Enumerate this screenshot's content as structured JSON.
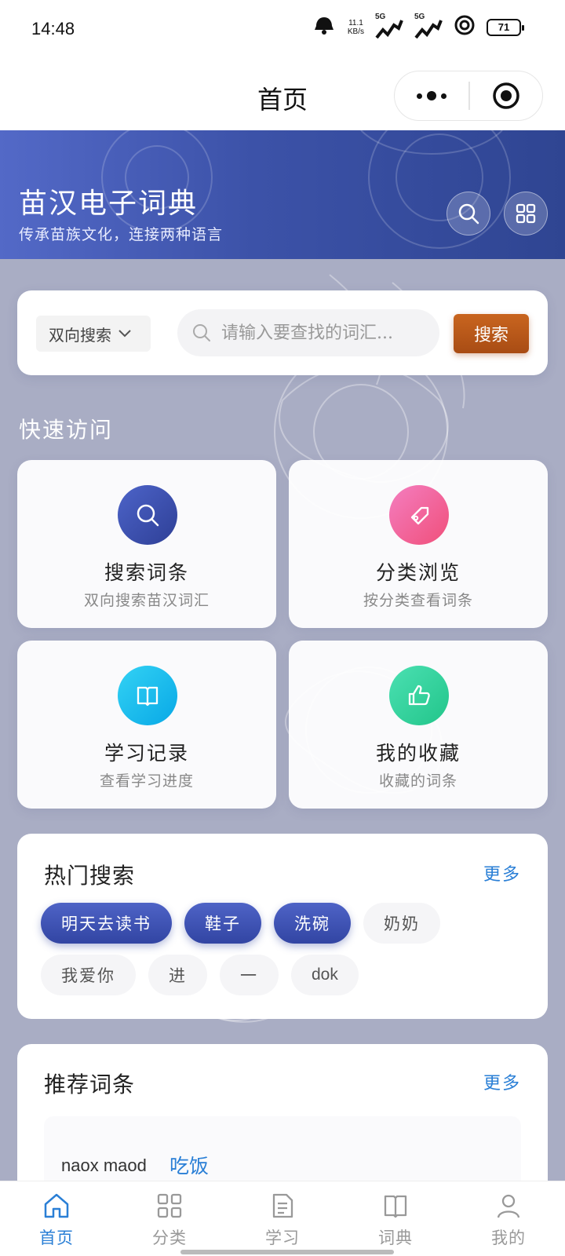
{
  "status_bar": {
    "time": "14:48",
    "net_speed_value": "11.1",
    "net_speed_unit": "KB/s",
    "signal_1": "5G",
    "signal_2": "5G",
    "battery": "71"
  },
  "nav": {
    "title": "首页"
  },
  "banner": {
    "title": "苗汉电子词典",
    "subtitle": "传承苗族文化，连接两种语言"
  },
  "search": {
    "mode": "双向搜索",
    "placeholder": "请输入要查找的词汇...",
    "button": "搜索"
  },
  "quick_access": {
    "label": "快速访问",
    "items": [
      {
        "title": "搜索词条",
        "subtitle": "双向搜索苗汉词汇",
        "icon": "search-icon",
        "color": "#3a4fb0"
      },
      {
        "title": "分类浏览",
        "subtitle": "按分类查看词条",
        "icon": "tag-icon",
        "color": "#f0609a"
      },
      {
        "title": "学习记录",
        "subtitle": "查看学习进度",
        "icon": "book-icon",
        "color": "#1cc8f0"
      },
      {
        "title": "我的收藏",
        "subtitle": "收藏的词条",
        "icon": "thumbs-up-icon",
        "color": "#33d6a0"
      }
    ]
  },
  "hot_search": {
    "title": "热门搜索",
    "more": "更多",
    "tags": [
      {
        "text": "明天去读书",
        "hot": true
      },
      {
        "text": "鞋子",
        "hot": true
      },
      {
        "text": "洗碗",
        "hot": true
      },
      {
        "text": "奶奶",
        "hot": false
      },
      {
        "text": "我爱你",
        "hot": false
      },
      {
        "text": "进",
        "hot": false
      },
      {
        "text": "一",
        "hot": false
      },
      {
        "text": "dok",
        "hot": false
      }
    ]
  },
  "recommend": {
    "title": "推荐词条",
    "more": "更多",
    "item": {
      "miao": "naox maod",
      "han": "吃饭"
    }
  },
  "tab_bar": {
    "tabs": [
      {
        "label": "首页",
        "icon": "home-icon",
        "active": true
      },
      {
        "label": "分类",
        "icon": "grid-icon",
        "active": false
      },
      {
        "label": "学习",
        "icon": "document-icon",
        "active": false
      },
      {
        "label": "词典",
        "icon": "book-icon",
        "active": false
      },
      {
        "label": "我的",
        "icon": "user-icon",
        "active": false
      }
    ]
  },
  "colors": {
    "primary": "#3a4fb0",
    "accent": "#2a7fd6",
    "search_button": "#b8561a"
  }
}
